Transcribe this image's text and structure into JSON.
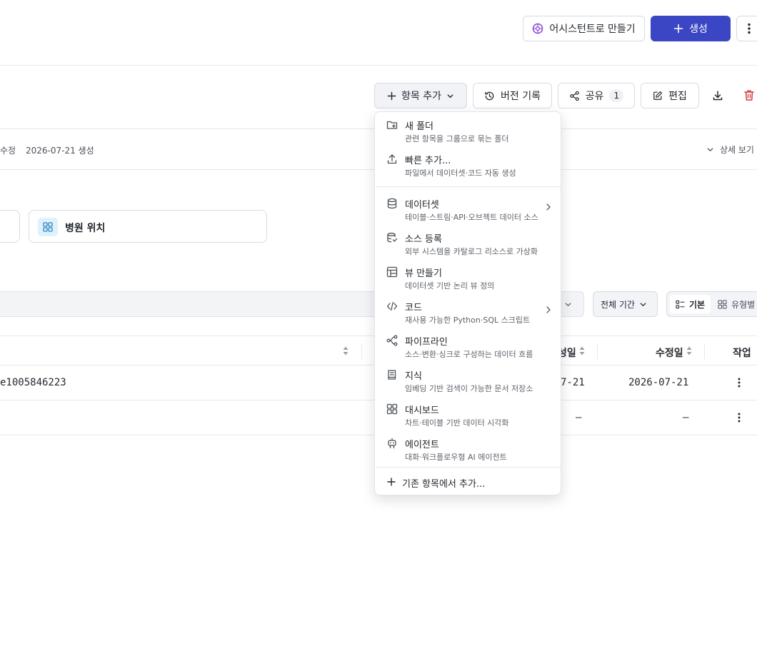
{
  "header": {
    "assistant_label": "어시스턴트로 만들기",
    "create_label": "생성"
  },
  "toolbar": {
    "add_item_label": "항목 추가",
    "version_history_label": "버전 기록",
    "share_label": "공유",
    "share_count": "1",
    "edit_label": "편집"
  },
  "meta": {
    "modified_label": "수정",
    "created_label": "2026-07-21 생성",
    "details_label": "상세 보기"
  },
  "cards": {
    "hospital_location": "병원 위치"
  },
  "filters": {
    "all_period": "전체 기간",
    "view_basic": "기본",
    "view_by_type": "유형별"
  },
  "table": {
    "headers": {
      "created": "성일",
      "modified": "수정일",
      "actions": "작업"
    },
    "rows": [
      {
        "name": "e1005846223",
        "created": "7-21",
        "modified": "2026-07-21"
      },
      {
        "name": "",
        "created": "—",
        "modified": "—"
      }
    ]
  },
  "menu": {
    "items": [
      {
        "title": "새 폴더",
        "desc": "관련 항목을 그룹으로 묶는 폴더",
        "icon": "folder-plus-icon"
      },
      {
        "title": "빠른 추가...",
        "desc": "파일에서 데이터셋·코드 자동 생성",
        "icon": "upload-icon"
      },
      {
        "title": "데이터셋",
        "desc": "테이블·스트림·API·오브젝트 데이터 소스",
        "icon": "database-icon"
      },
      {
        "title": "소스 등록",
        "desc": "외부 시스템을 카탈로그 리소스로 가상화",
        "icon": "database-link-icon"
      },
      {
        "title": "뷰 만들기",
        "desc": "데이터셋 기반 논리 뷰 정의",
        "icon": "table-view-icon"
      },
      {
        "title": "코드",
        "desc": "재사용 가능한 Python·SQL 스크립트",
        "icon": "code-icon"
      },
      {
        "title": "파이프라인",
        "desc": "소스·변환·싱크로 구성하는 데이터 흐름",
        "icon": "pipeline-icon"
      },
      {
        "title": "지식",
        "desc": "임베딩 기반 검색이 가능한 문서 저장소",
        "icon": "book-icon"
      },
      {
        "title": "대시보드",
        "desc": "차트·테이블 기반 데이터 시각화",
        "icon": "dashboard-icon"
      },
      {
        "title": "에이전트",
        "desc": "대화·워크플로우형 AI 에이전트",
        "icon": "robot-icon"
      }
    ],
    "footer": {
      "label": "기존 항목에서 추가..."
    }
  }
}
